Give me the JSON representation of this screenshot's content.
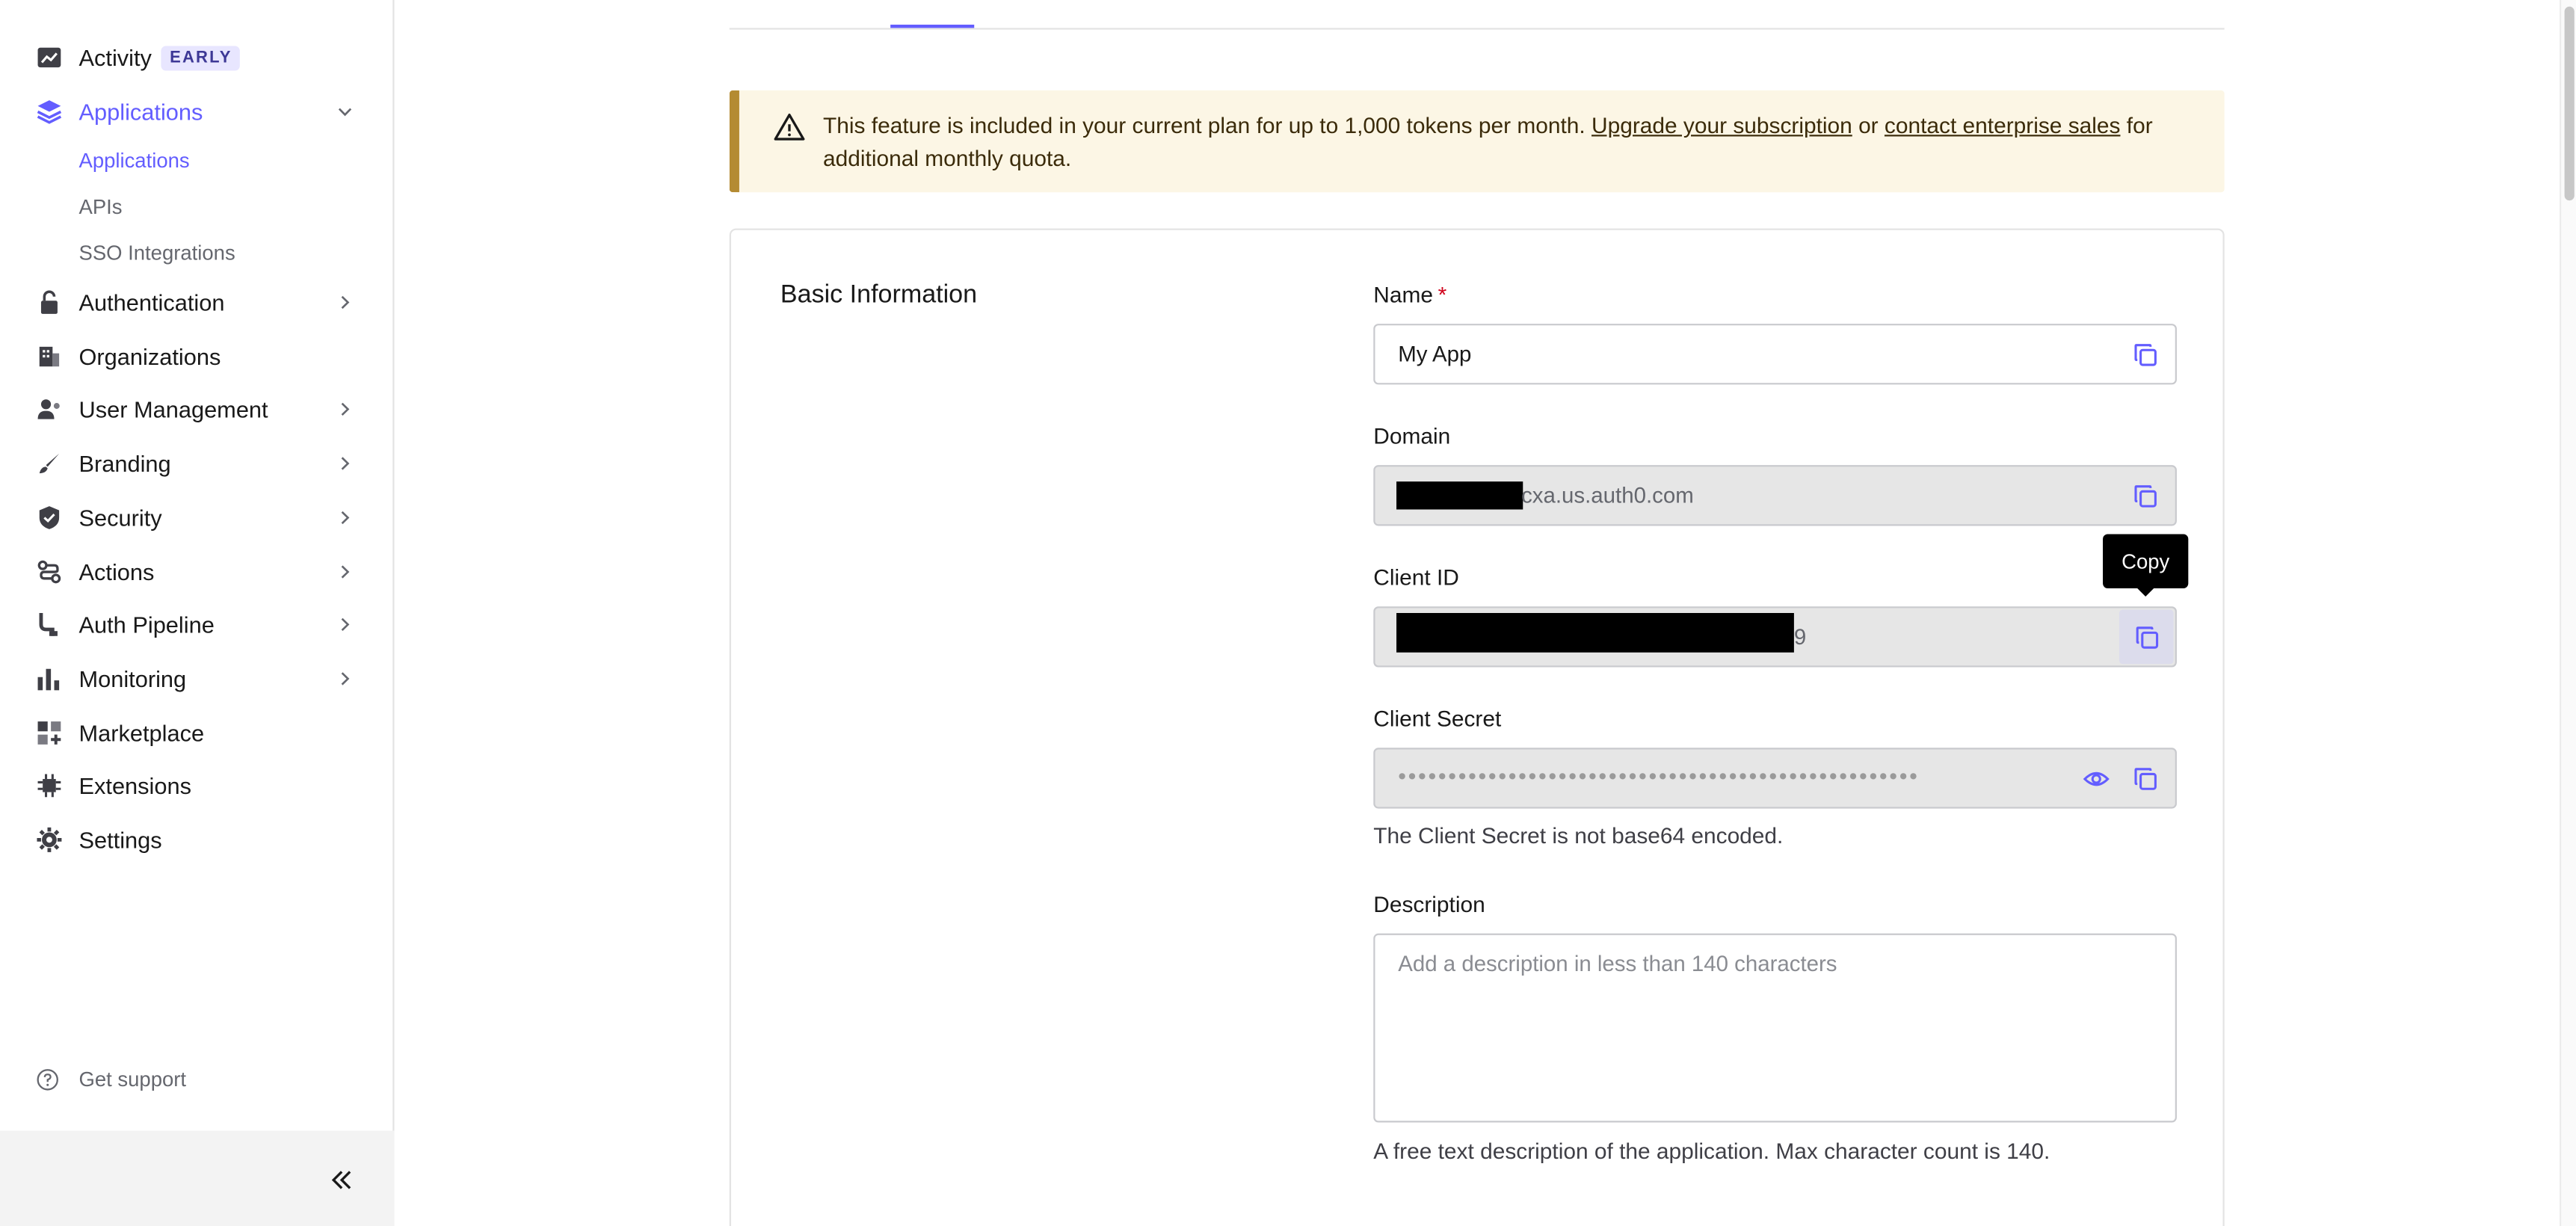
{
  "sidebar": {
    "items": [
      {
        "label": "Activity",
        "icon": "activity-icon",
        "badge": "EARLY"
      },
      {
        "label": "Applications",
        "icon": "applications-icon",
        "expanded": true,
        "active": true,
        "children": [
          {
            "label": "Applications",
            "active": true
          },
          {
            "label": "APIs"
          },
          {
            "label": "SSO Integrations"
          }
        ]
      },
      {
        "label": "Authentication",
        "icon": "lock-icon",
        "has_children": true
      },
      {
        "label": "Organizations",
        "icon": "building-icon"
      },
      {
        "label": "User Management",
        "icon": "users-icon",
        "has_children": true
      },
      {
        "label": "Branding",
        "icon": "brush-icon",
        "has_children": true
      },
      {
        "label": "Security",
        "icon": "shield-icon",
        "has_children": true
      },
      {
        "label": "Actions",
        "icon": "actions-icon",
        "has_children": true
      },
      {
        "label": "Auth Pipeline",
        "icon": "pipeline-icon",
        "has_children": true
      },
      {
        "label": "Monitoring",
        "icon": "bar-chart-icon",
        "has_children": true
      },
      {
        "label": "Marketplace",
        "icon": "grid-plus-icon"
      },
      {
        "label": "Extensions",
        "icon": "chip-icon"
      },
      {
        "label": "Settings",
        "icon": "gear-icon"
      }
    ],
    "support_label": "Get support"
  },
  "banner": {
    "text_before": "This feature is included in your current plan for up to 1,000 tokens per month. ",
    "link1": "Upgrade your subscription",
    "text_mid": " or ",
    "link2": "contact enterprise sales",
    "text_after": " for additional monthly quota."
  },
  "basic_info": {
    "title": "Basic Information",
    "name_label": "Name",
    "required_mark": "*",
    "name_value": "My App",
    "domain_label": "Domain",
    "domain_value": "cxa.us.auth0.com",
    "client_id_label": "Client ID",
    "client_id_value": "9",
    "client_secret_label": "Client Secret",
    "client_secret_masked": "••••••••••••••••••••••••••••••••••••••••••••••••••••",
    "client_secret_help": "The Client Secret is not base64 encoded.",
    "description_label": "Description",
    "description_placeholder": "Add a description in less than 140 characters",
    "description_help": "A free text description of the application. Max character count is 140."
  },
  "tooltip": {
    "text": "Copy"
  },
  "colors": {
    "accent": "#635dff",
    "warning_bar": "#b48b32",
    "warning_bg": "#fcf6e5"
  }
}
